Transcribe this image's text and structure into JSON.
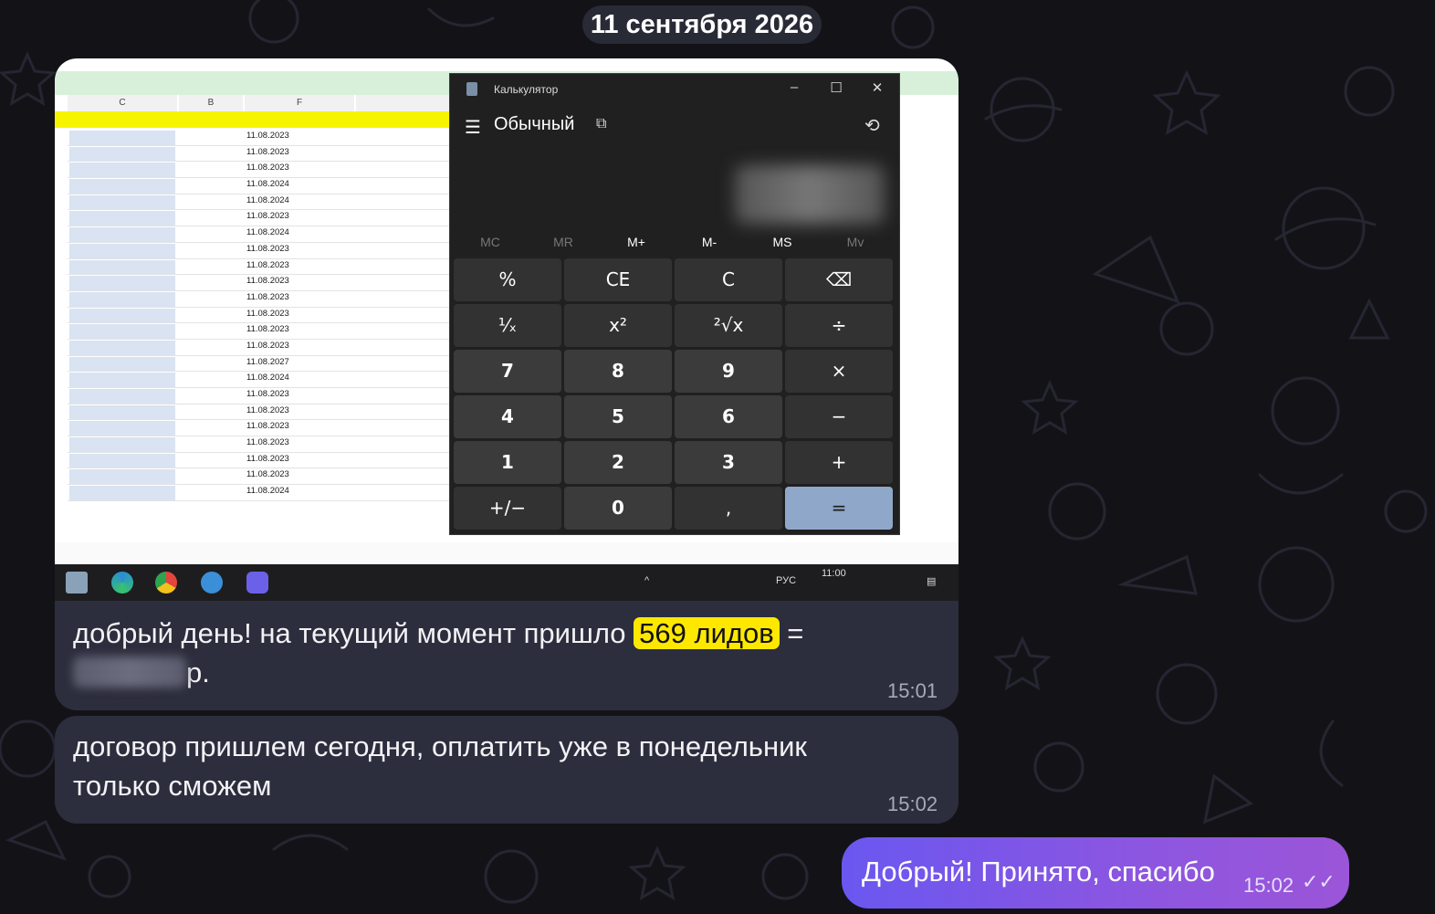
{
  "chat": {
    "date": "11 сентября 2026"
  },
  "message1": {
    "text_before": "добрый день! на текущий момент пришло ",
    "highlight": "569 лидов",
    "text_after_eq": " =",
    "text_currency": "р.",
    "time": "15:01"
  },
  "message2": {
    "line1": "договор пришлем сегодня, оплатить уже в понедельник",
    "line2": "только сможем",
    "time": "15:02"
  },
  "message3": {
    "text": "Добрый! Принято, спасибо",
    "time": "15:02",
    "read_icon": "double-check-icon"
  },
  "screenshot": {
    "calculator": {
      "title": "Калькулятор",
      "mode": "Обычный",
      "memory": [
        "MC",
        "MR",
        "M+",
        "M-",
        "MS",
        "Mv"
      ],
      "keys": [
        [
          "%",
          "CE",
          "C",
          "⌫"
        ],
        [
          "¹⁄ₓ",
          "x²",
          "²√x",
          "÷"
        ],
        [
          "7",
          "8",
          "9",
          "×"
        ],
        [
          "4",
          "5",
          "6",
          "−"
        ],
        [
          "1",
          "2",
          "3",
          "+"
        ],
        [
          "+/−",
          "0",
          ",",
          "="
        ]
      ]
    },
    "spreadsheet": {
      "columns": [
        "C",
        "B",
        "F",
        ""
      ],
      "rows": [
        [
          "11.08.2023"
        ],
        [
          "11.08.2023"
        ],
        [
          "11.08.2023"
        ],
        [
          "11.08.2024"
        ],
        [
          "11.08.2024"
        ],
        [
          "11.08.2023"
        ],
        [
          "11.08.2024"
        ],
        [
          "11.08.2023"
        ],
        [
          "11.08.2023"
        ],
        [
          "11.08.2023"
        ],
        [
          "11.08.2023"
        ],
        [
          "11.08.2023"
        ],
        [
          "11.08.2023"
        ],
        [
          "11.08.2023"
        ],
        [
          "11.08.2027"
        ],
        [
          "11.08.2024"
        ],
        [
          "11.08.2023"
        ],
        [
          "11.08.2023"
        ],
        [
          "11.08.2023"
        ],
        [
          "11.08.2023"
        ],
        [
          "11.08.2023"
        ],
        [
          "11.08.2023"
        ],
        [
          "11.08.2024"
        ]
      ]
    },
    "taskbar": {
      "lang": "РУС",
      "clock": "11:00"
    }
  }
}
